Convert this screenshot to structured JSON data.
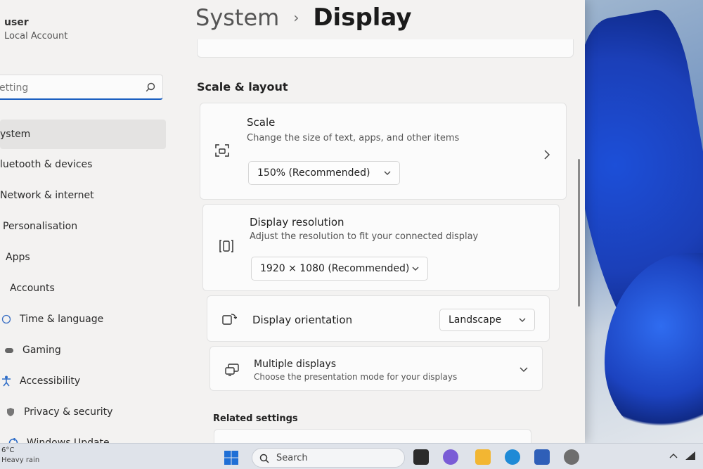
{
  "user": {
    "name": "user",
    "account_type": "Local Account"
  },
  "search": {
    "placeholder": "etting"
  },
  "nav": [
    {
      "label": "ystem",
      "icon": "system-icon",
      "active": true
    },
    {
      "label": "luetooth & devices",
      "icon": "bluetooth-icon"
    },
    {
      "label": "Network & internet",
      "icon": "network-icon"
    },
    {
      "label": "Personalisation",
      "icon": "brush-icon"
    },
    {
      "label": "Apps",
      "icon": "apps-icon"
    },
    {
      "label": "Accounts",
      "icon": "person-icon"
    },
    {
      "label": "Time & language",
      "icon": "globe-icon"
    },
    {
      "label": "Gaming",
      "icon": "controller-icon"
    },
    {
      "label": "Accessibility",
      "icon": "accessibility-icon"
    },
    {
      "label": "Privacy & security",
      "icon": "shield-icon"
    },
    {
      "label": "Windows Update",
      "icon": "update-icon"
    }
  ],
  "breadcrumb": {
    "parent": "System",
    "separator": "›",
    "current": "Display"
  },
  "section_title": "Scale & layout",
  "scale": {
    "title": "Scale",
    "description": "Change the size of text, apps, and other items",
    "value": "150% (Recommended)"
  },
  "resolution": {
    "title": "Display resolution",
    "description": "Adjust the resolution to fit your connected display",
    "value": "1920 × 1080 (Recommended)"
  },
  "orientation": {
    "title": "Display orientation",
    "value": "Landscape"
  },
  "multiple": {
    "title": "Multiple displays",
    "description": "Choose the presentation mode for your displays"
  },
  "related_settings": "Related settings",
  "taskbar": {
    "weather_temp": "6°C",
    "weather_desc": "Heavy rain",
    "search_label": "Search"
  },
  "colors": {
    "accent": "#1b5fc1",
    "window_bg": "#f3f2f1",
    "card_bg": "#fbfbfb"
  }
}
